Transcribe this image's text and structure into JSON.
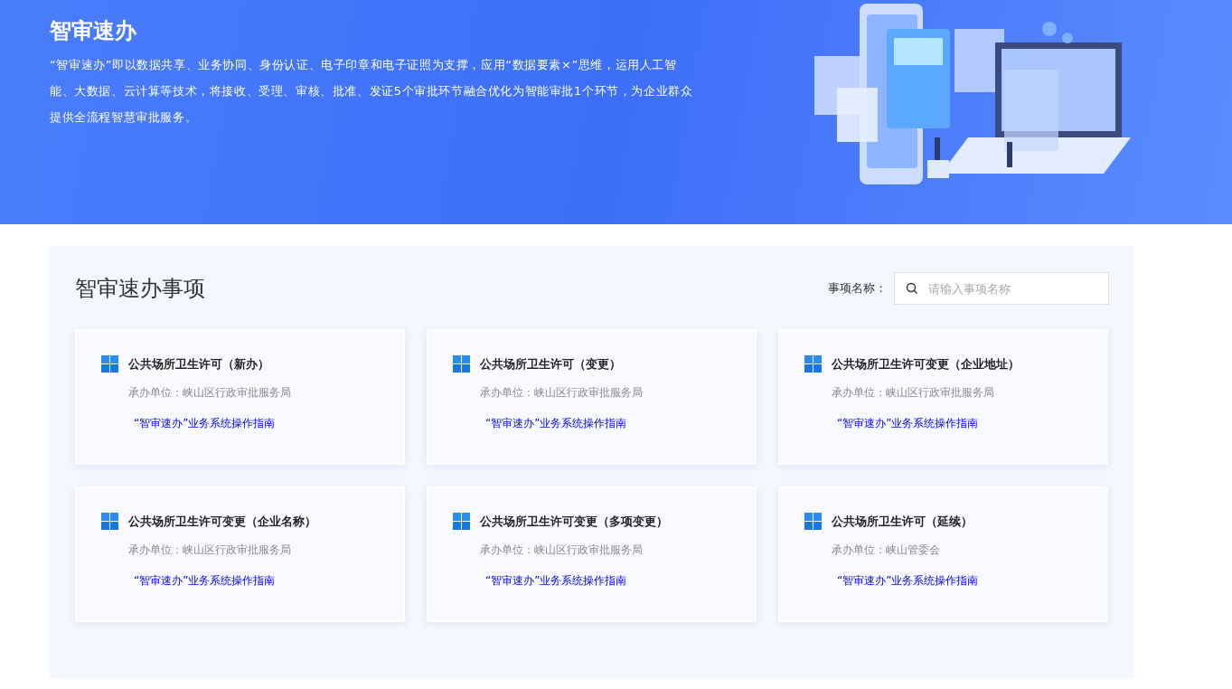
{
  "banner": {
    "title": "智审速办",
    "description": "“智审速办”即以数据共享、业务协同、身份认证、电子印章和电子证照为支撑，应用“数据要素×”思维，运用人工智能、大数据、云计算等技术，将接收、受理、审核、批准、发证5个审批环节融合优化为智能审批1个环节，为企业群众提供全流程智慧审批服务。"
  },
  "section": {
    "title": "智审速办事项",
    "search": {
      "label": "事项名称：",
      "placeholder": "请输入事项名称"
    },
    "items": [
      {
        "title": "公共场所卫生许可（新办）",
        "unit": "承办单位：峡山区行政审批服务局",
        "link": "“智审速办”业务系统操作指南"
      },
      {
        "title": "公共场所卫生许可（变更）",
        "unit": "承办单位：峡山区行政审批服务局",
        "link": "“智审速办”业务系统操作指南"
      },
      {
        "title": "公共场所卫生许可变更（企业地址）",
        "unit": "承办单位：峡山区行政审批服务局",
        "link": "“智审速办”业务系统操作指南"
      },
      {
        "title": "公共场所卫生许可变更（企业名称）",
        "unit": "承办单位：峡山区行政审批服务局",
        "link": "“智审速办”业务系统操作指南"
      },
      {
        "title": "公共场所卫生许可变更（多项变更）",
        "unit": "承办单位：峡山区行政审批服务局",
        "link": "“智审速办”业务系统操作指南"
      },
      {
        "title": "公共场所卫生许可（延续）",
        "unit": "承办单位：峡山管委会",
        "link": "“智审速办”业务系统操作指南"
      }
    ]
  }
}
